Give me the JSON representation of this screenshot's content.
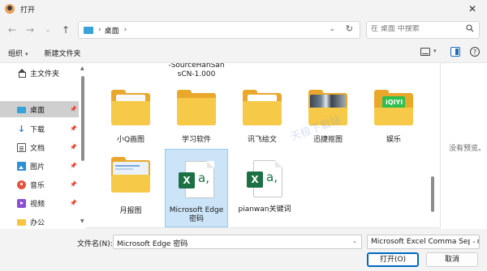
{
  "window": {
    "title": "打开"
  },
  "address": {
    "crumb": "桌面",
    "separator": "›",
    "dropdown_icon": "chevron-down-icon",
    "refresh_icon": "refresh-icon"
  },
  "search": {
    "placeholder": "在 桌面 中搜索"
  },
  "toolbar": {
    "organize_label": "组织",
    "new_folder_label": "新建文件夹"
  },
  "sidebar": {
    "items": [
      {
        "label": "主文件夹",
        "icon": "home-icon",
        "pinned": false
      },
      {
        "label": "桌面",
        "icon": "desktop-icon",
        "pinned": true,
        "selected": true
      },
      {
        "label": "下载",
        "icon": "download-icon",
        "pinned": true
      },
      {
        "label": "文档",
        "icon": "document-icon",
        "pinned": true
      },
      {
        "label": "图片",
        "icon": "pictures-icon",
        "pinned": true
      },
      {
        "label": "音乐",
        "icon": "music-icon",
        "pinned": true
      },
      {
        "label": "视频",
        "icon": "video-icon",
        "pinned": true
      },
      {
        "label": "办公",
        "icon": "folder-icon",
        "pinned": false
      }
    ]
  },
  "content": {
    "partial_top_label": "-SourceHanSan sCN-1.000",
    "tiles": [
      {
        "label": "小Q画图",
        "type": "folder",
        "preview": "document"
      },
      {
        "label": "学习软件",
        "type": "folder",
        "preview": "none"
      },
      {
        "label": "讯飞绘文",
        "type": "folder",
        "preview": "document"
      },
      {
        "label": "迅捷抠图",
        "type": "folder",
        "preview": "photo"
      },
      {
        "label": "娱乐",
        "type": "folder",
        "preview": "iqiyi"
      },
      {
        "label": "月报图",
        "type": "folder",
        "preview": "screenshot"
      },
      {
        "label": "Microsoft Edge 密码",
        "type": "excel",
        "selected": true
      },
      {
        "label": "pianwan关键词",
        "type": "excel"
      }
    ]
  },
  "preview": {
    "text": "没有预览。"
  },
  "watermark": {
    "text": "天极下载站"
  },
  "footer": {
    "filename_label": "文件名(N):",
    "filename_value": "Microsoft Edge 密码",
    "filetype_value": "Microsoft Excel Comma Separated",
    "open_label": "打开(O)",
    "cancel_label": "取消"
  },
  "colors": {
    "accent": "#0067c0",
    "excel_green": "#1d7044",
    "folder_yellow": "#f7c948",
    "selection": "#cce4f7"
  }
}
